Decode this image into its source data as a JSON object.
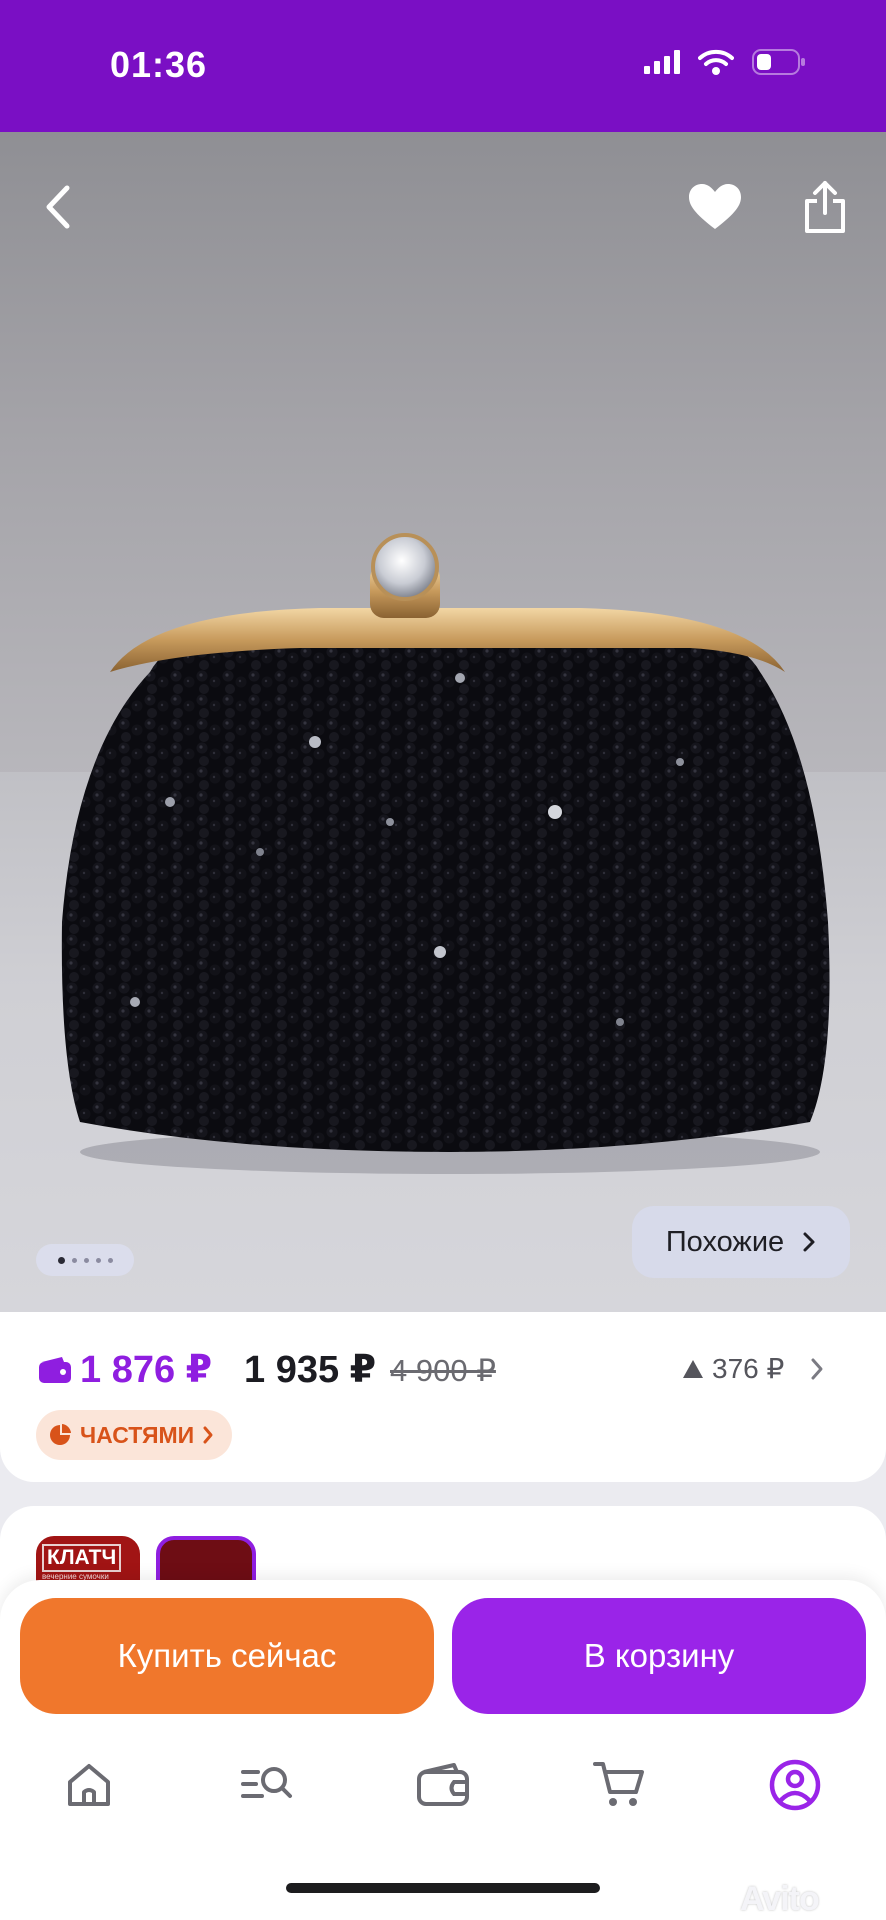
{
  "status_bar": {
    "time": "01:36"
  },
  "gallery": {
    "similar_label": "Похожие",
    "page_count": 5,
    "current_page": 1
  },
  "price": {
    "wallet_price": "1 876 ₽",
    "price": "1 935 ₽",
    "old_price": "4 900 ₽",
    "price_change": "376 ₽",
    "installments_label": "ЧАСТЯМИ"
  },
  "seller": {
    "thumb_label": "КЛАТЧ",
    "thumb_sublabel": "вечерние сумочки"
  },
  "actions": {
    "buy_now": "Купить сейчас",
    "add_to_cart": "В корзину"
  },
  "tabs": [
    {
      "icon": "home-icon"
    },
    {
      "icon": "search-list-icon"
    },
    {
      "icon": "wallet-icon"
    },
    {
      "icon": "cart-icon"
    },
    {
      "icon": "profile-icon",
      "active": true
    }
  ],
  "colors": {
    "brand_purple": "#7a0fc4",
    "wallet_purple": "#8f1ee0",
    "buy_orange": "#f0772c",
    "cart_purple": "#9a24e8"
  },
  "watermark": "Avito"
}
